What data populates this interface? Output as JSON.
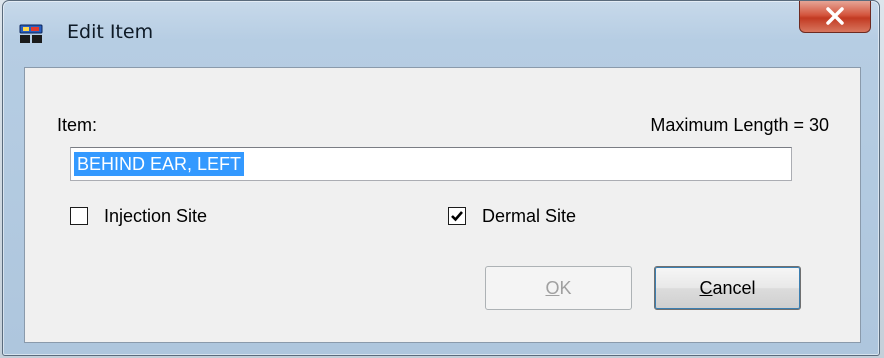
{
  "window": {
    "title": "Edit Item"
  },
  "form": {
    "item_label": "Item:",
    "max_length_label": "Maximum Length = 30",
    "item_value": "BEHIND EAR, LEFT"
  },
  "options": {
    "injection_site_label": "Injection Site",
    "injection_site_checked": false,
    "dermal_site_label": "Dermal Site",
    "dermal_site_checked": true
  },
  "buttons": {
    "ok_label": "OK",
    "ok_enabled": false,
    "cancel_label": "Cancel"
  },
  "colors": {
    "selection": "#3399ff",
    "close_button": "#c23a22",
    "client_bg": "#f0f0f0"
  },
  "icons": {
    "app": "app-window-icon",
    "close": "close-x-icon",
    "check": "checkmark-icon"
  }
}
